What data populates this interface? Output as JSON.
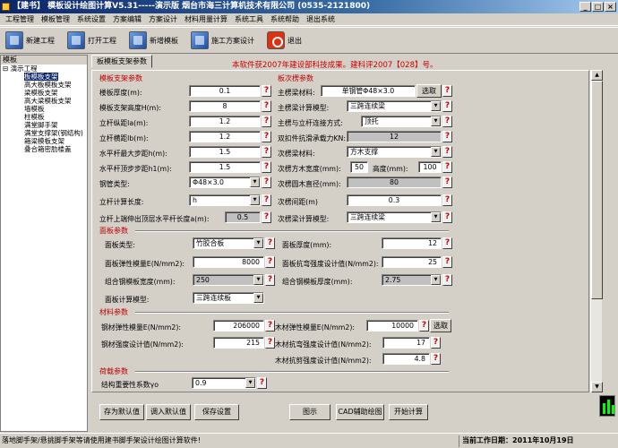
{
  "window": {
    "title": "【建书】 模板设计绘图计算V5.31-----演示版  烟台市海三计算机技术有限公司 (0535-2121800)",
    "btn_min": "_",
    "btn_max": "□",
    "btn_close": "×"
  },
  "menu": [
    "工程管理",
    "模板管理",
    "系统设置",
    "方案编辑",
    "方案设计",
    "材料用量计算",
    "系统工具",
    "系统帮助",
    "退出系统"
  ],
  "toolbar": [
    {
      "label": "新建工程",
      "icon": "new-project-icon"
    },
    {
      "label": "打开工程",
      "icon": "open-project-icon"
    },
    {
      "label": "新增模板",
      "icon": "add-template-icon"
    },
    {
      "label": "施工方案设计",
      "icon": "construction-plan-icon"
    },
    {
      "label": "退出",
      "icon": "power-icon"
    }
  ],
  "tree": {
    "title": "模板",
    "root": "演示工程",
    "items": [
      "板模板支架",
      "高大板模板支架",
      "梁模板支架",
      "高大梁模板支架",
      "墙模板",
      "柱模板",
      "满堂脚手架",
      "满堂支撑架(钢结构)",
      "箱梁模板支架",
      "叠合箱密肋楼盖"
    ],
    "selected_index": 0
  },
  "tab": "板模板支架参数",
  "notice": "本软件获2007年建设部科技成果。建科评2007【028】号。",
  "sections": {
    "template_support": "模板支架参数",
    "secondary_beam": "板次楞参数",
    "panel": "面板参数",
    "material": "材料参数",
    "load": "荷载参数"
  },
  "fields": {
    "thickness_label": "楼板厚度(m):",
    "thickness": "0.1",
    "height_label": "模板支架高度H(m):",
    "height": "8",
    "la_label": "立杆纵距la(m):",
    "la": "1.2",
    "lb_label": "立杆横距lb(m):",
    "lb": "1.2",
    "h_label": "水平杆最大步距h(m):",
    "h": "1.5",
    "h1_label": "水平杆顶步步距h1(m):",
    "h1": "1.5",
    "pipe_label": "钢管类型:",
    "pipe": "Φ48×3.0",
    "calclen_label": "立杆计算长度:",
    "calclen": "h",
    "a_label": "立杆上端伸出顶层水平杆长度a(m):",
    "a": "0.5",
    "main_mat_label": "主楞梁材料:",
    "main_mat": "单钢管Φ48×3.0",
    "select_btn": "选取",
    "main_model_label": "主楞梁计算模型:",
    "main_model": "三跨连续梁",
    "conn_label": "主楞与立杆连接方式:",
    "conn": "顶托",
    "kn_label": "双扣件抗滑承载力KN:",
    "kn": "12",
    "sec_mat_label": "次楞梁材料:",
    "sec_mat": "方木支撑",
    "wood_w_label": "次楞方木宽度(mm):",
    "wood_w": "50",
    "wood_h_label": "高度(mm):",
    "wood_h": "100",
    "round_d_label": "次楞圆木直径(mm):",
    "round_d": "80",
    "sec_spacing_label": "次楞间距(m)",
    "sec_spacing": "0.3",
    "sec_model_label": "次楞梁计算模型:",
    "sec_model": "三跨连续梁",
    "panel_type_label": "面板类型:",
    "panel_type": "竹胶合板",
    "panel_thick_label": "面板厚度(mm):",
    "panel_thick": "12",
    "panel_e_label": "面板弹性模量E(N/mm2):",
    "panel_e": "8000",
    "panel_f_label": "面板抗弯强度设计值(N/mm2):",
    "panel_f": "25",
    "steel_w_label": "组合钢模板宽度(mm):",
    "steel_w": "250",
    "steel_t_label": "组合钢模板厚度(mm):",
    "steel_t": "2.75",
    "panel_model_label": "面板计算模型:",
    "panel_model": "三跨连续板",
    "steel_e_label": "钢材弹性模量E(N/mm2):",
    "steel_e": "206000",
    "wood_e_label": "木材弹性模量E(N/mm2):",
    "wood_e": "10000",
    "select_btn2": "选取",
    "steel_f_label": "钢材强度设计值(N/mm2):",
    "steel_f": "215",
    "wood_f_label": "木材抗弯强度设计值(N/mm2):",
    "wood_f": "17",
    "wood_v_label": "木材抗剪强度设计值(N/mm2):",
    "wood_v": "4.8",
    "gamma_label": "结构重要性系数γo",
    "gamma": "0.9"
  },
  "help": "?",
  "bottom_buttons": [
    "存为默认值",
    "调入默认值",
    "保存设置",
    "图示",
    "CAD辅助绘图",
    "开始计算"
  ],
  "status": {
    "left": "落地脚手架/悬挑脚手架等请使用建书脚手架设计绘图计算软件!",
    "right": "当前工作日期：2011年10月19日"
  }
}
